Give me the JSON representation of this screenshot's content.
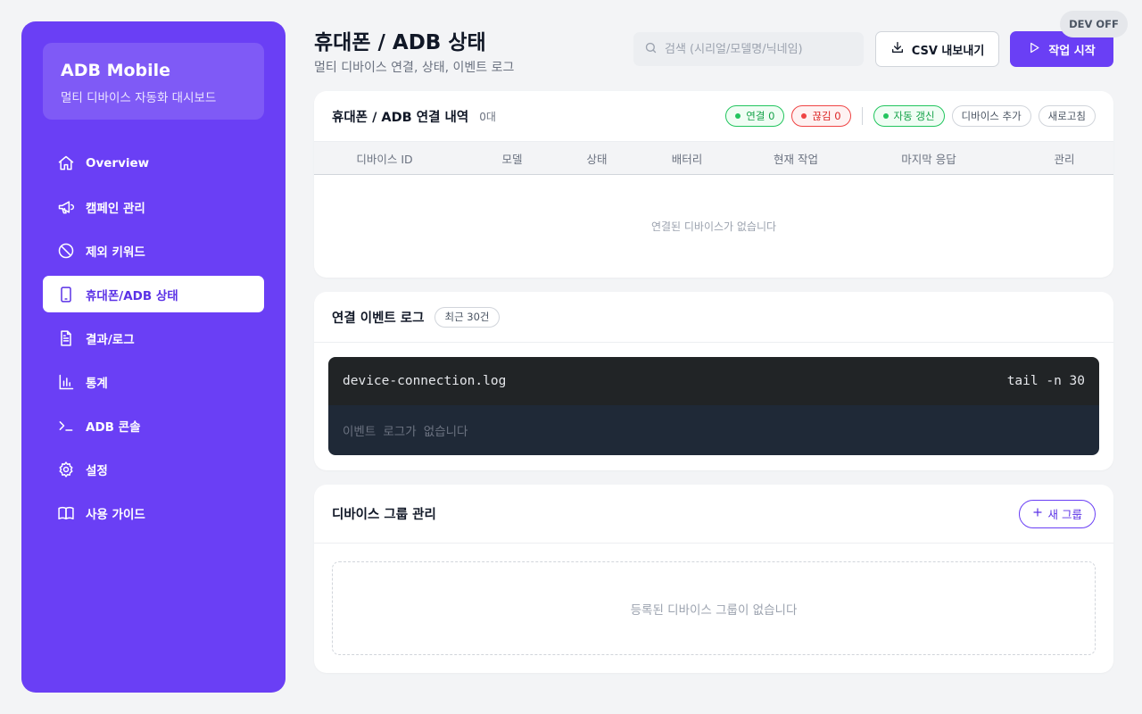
{
  "sidebar": {
    "brand_title": "ADB Mobile",
    "brand_subtitle": "멀티 디바이스 자동화 대시보드",
    "items": [
      {
        "label": "Overview",
        "icon": "home-icon"
      },
      {
        "label": "캠페인 관리",
        "icon": "megaphone-icon"
      },
      {
        "label": "제외 키워드",
        "icon": "ban-icon"
      },
      {
        "label": "휴대폰/ADB 상태",
        "icon": "phone-icon",
        "active": true
      },
      {
        "label": "결과/로그",
        "icon": "document-icon"
      },
      {
        "label": "통계",
        "icon": "bar-chart-icon"
      },
      {
        "label": "ADB 콘솔",
        "icon": "terminal-icon"
      },
      {
        "label": "설정",
        "icon": "gear-icon"
      },
      {
        "label": "사용 가이드",
        "icon": "book-icon"
      }
    ]
  },
  "header": {
    "title": "휴대폰 / ADB 상태",
    "subtitle": "멀티 디바이스 연결, 상태, 이벤트 로그",
    "search_placeholder": "검색 (시리얼/모델명/닉네임)",
    "csv_label": "CSV 내보내기",
    "start_label": "작업 시작",
    "dev_badge": "DEV OFF"
  },
  "connections": {
    "title": "휴대폰 / ADB 연결 내역",
    "count": "0대",
    "connected_label": "연결 0",
    "disconnected_label": "끊김 0",
    "auto_refresh_label": "자동 갱신",
    "add_device_label": "디바이스 추가",
    "refresh_label": "새로고침",
    "columns": [
      "디바이스 ID",
      "모델",
      "상태",
      "배터리",
      "현재 작업",
      "마지막 응답",
      "관리"
    ],
    "empty_text": "연결된 디바이스가 없습니다"
  },
  "event_log": {
    "title": "연결 이벤트 로그",
    "badge": "최근 30건",
    "filename": "device-connection.log",
    "command": "tail -n 30",
    "empty_text": "이벤트 로그가 없습니다"
  },
  "groups": {
    "title": "디바이스 그룹 관리",
    "new_group_label": "새 그룹",
    "empty_text": "등록된 디바이스 그룹이 없습니다"
  },
  "colors": {
    "accent": "#6a3ff5",
    "connected": "#22c55e",
    "disconnected": "#ef4444"
  }
}
